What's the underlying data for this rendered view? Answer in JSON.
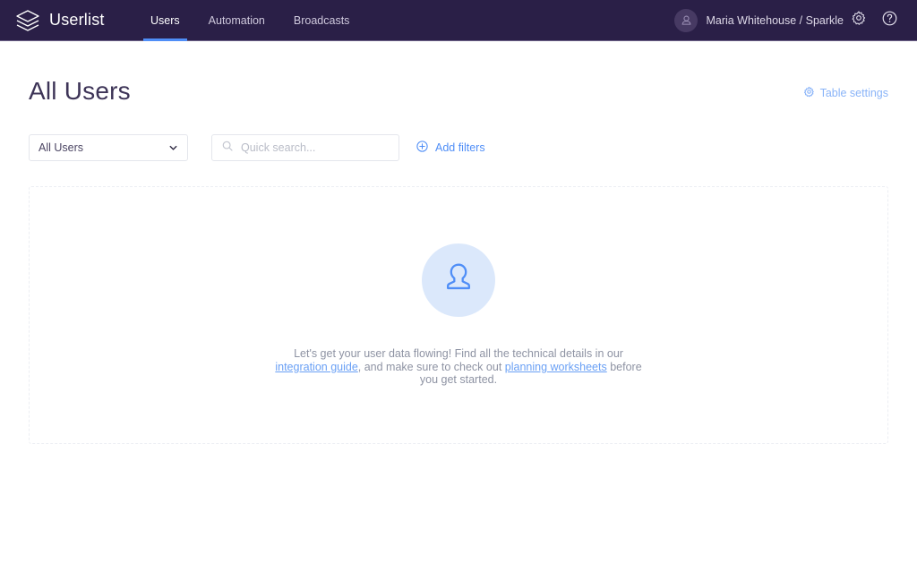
{
  "header": {
    "brand": {
      "name": "Userlist",
      "logo_icon": "layers-stack-icon"
    },
    "nav": [
      {
        "label": "Users",
        "active": true
      },
      {
        "label": "Automation",
        "active": false
      },
      {
        "label": "Broadcasts",
        "active": false
      }
    ],
    "account": {
      "name": "Maria Whitehouse / Sparkle",
      "avatar_icon": "user-avatar-icon"
    },
    "settings_icon": "gear-icon",
    "help_icon": "question-circle-icon",
    "active_tab_color": "#4f8ef7",
    "background_color": "#2a1f47"
  },
  "page": {
    "title": "All Users",
    "table_settings": {
      "label": "Table settings",
      "icon": "gear-icon",
      "color": "#8ab4f8"
    }
  },
  "toolbar": {
    "segment_select": {
      "value": "All Users",
      "chevron_icon": "chevron-down-icon"
    },
    "search": {
      "value": "",
      "placeholder": "Quick search...",
      "icon": "search-icon"
    },
    "add_filters": {
      "label": "Add filters",
      "icon": "plus-circle-icon",
      "color": "#4f8ef7"
    }
  },
  "empty_state": {
    "illustration_icon": "user-person-icon",
    "illustration_bg": "#dbe8fb",
    "illustration_fg": "#4f8ef7",
    "text_part_1": "Let's get your user data flowing! Find all the technical details in our ",
    "link_1": "integration guide",
    "text_part_2": ", and make sure to check out ",
    "link_2": "planning worksheets",
    "text_part_3": " before you get started."
  }
}
